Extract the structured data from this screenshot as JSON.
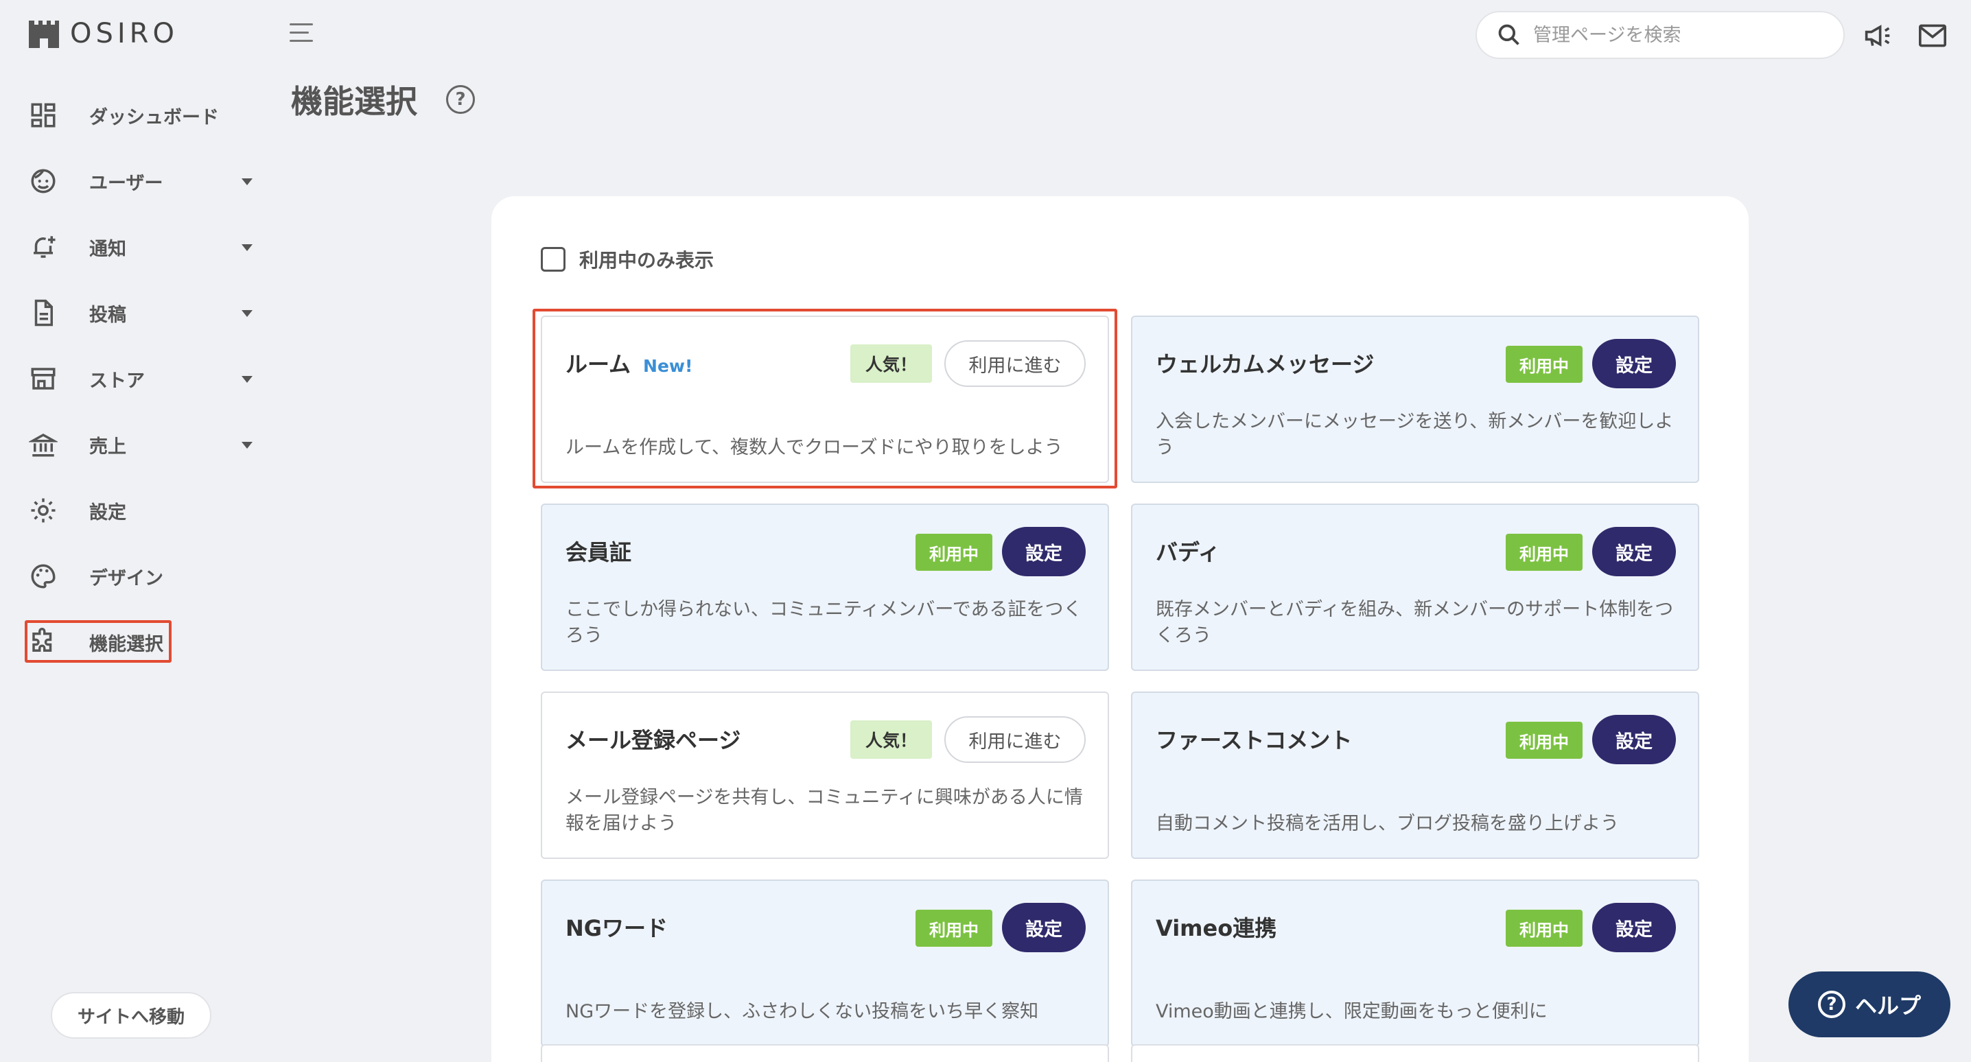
{
  "logo": {
    "text": "OSIRO"
  },
  "sidebar": {
    "items": [
      {
        "label": "ダッシュボード",
        "icon": "dashboard-icon",
        "caret": false
      },
      {
        "label": "ユーザー",
        "icon": "user-face-icon",
        "caret": true
      },
      {
        "label": "通知",
        "icon": "bell-add-icon",
        "caret": true
      },
      {
        "label": "投稿",
        "icon": "document-icon",
        "caret": true
      },
      {
        "label": "ストア",
        "icon": "store-icon",
        "caret": true
      },
      {
        "label": "売上",
        "icon": "bank-icon",
        "caret": true
      },
      {
        "label": "設定",
        "icon": "gear-icon",
        "caret": false
      },
      {
        "label": "デザイン",
        "icon": "palette-icon",
        "caret": false
      },
      {
        "label": "機能選択",
        "icon": "puzzle-icon",
        "caret": false,
        "active": true
      }
    ],
    "site_button": "サイトへ移動"
  },
  "header": {
    "title": "機能選択",
    "help_symbol": "?",
    "search_placeholder": "管理ページを検索"
  },
  "filter": {
    "label": "利用中のみ表示",
    "checked": false
  },
  "cards": [
    {
      "title": "ルーム",
      "new": "New!",
      "status": "popular",
      "badge": "人気！",
      "button": "利用に進む",
      "desc": "ルームを作成して、複数人でクローズドにやり取りをしよう",
      "highlighted": true
    },
    {
      "title": "ウェルカムメッセージ",
      "status": "in-use",
      "badge": "利用中",
      "button": "設定",
      "desc": "入会したメンバーにメッセージを送り、新メンバーを歓迎しよう"
    },
    {
      "title": "会員証",
      "status": "in-use",
      "badge": "利用中",
      "button": "設定",
      "desc": "ここでしか得られない、コミュニティメンバーである証をつくろう"
    },
    {
      "title": "バディ",
      "status": "in-use",
      "badge": "利用中",
      "button": "設定",
      "desc": "既存メンバーとバディを組み、新メンバーのサポート体制をつくろう"
    },
    {
      "title": "メール登録ページ",
      "status": "popular",
      "badge": "人気！",
      "button": "利用に進む",
      "desc": "メール登録ページを共有し、コミュニティに興味がある人に情報を届けよう"
    },
    {
      "title": "ファーストコメント",
      "status": "in-use",
      "badge": "利用中",
      "button": "設定",
      "desc": "自動コメント投稿を活用し、ブログ投稿を盛り上げよう"
    },
    {
      "title": "NGワード",
      "status": "in-use",
      "badge": "利用中",
      "button": "設定",
      "desc": "NGワードを登録し、ふさわしくない投稿をいち早く察知"
    },
    {
      "title": "Vimeo連携",
      "status": "in-use",
      "badge": "利用中",
      "button": "設定",
      "desc": "Vimeo動画と連携し、限定動画をもっと便利に"
    }
  ],
  "help_button": {
    "label": "ヘルプ",
    "symbol": "?"
  },
  "colors": {
    "accent_dark": "#2f2a6b",
    "in_use_green": "#7cc242",
    "popular_bg": "#d9f0c8",
    "new_blue": "#3a8fd6",
    "highlight_red": "#e24b32",
    "help_navy": "#1f3a66"
  }
}
